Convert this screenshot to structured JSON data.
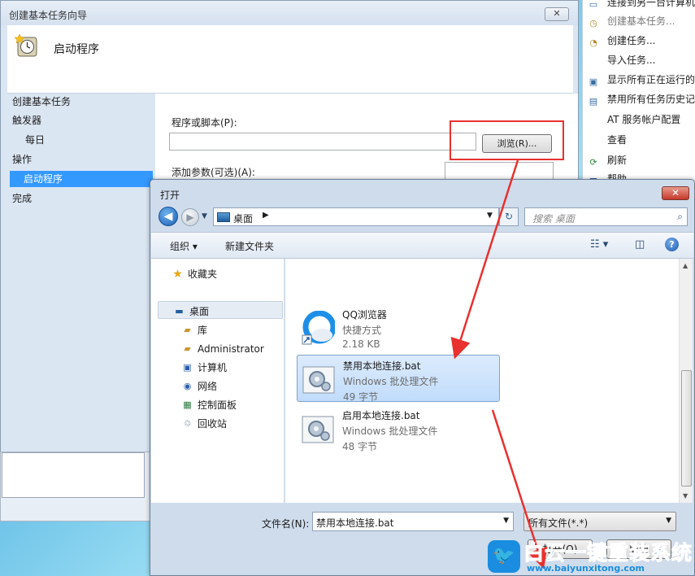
{
  "wizard": {
    "title": "创建基本任务向导",
    "close_label": "✕",
    "header_title": "启动程序",
    "nav": {
      "create": "创建基本任务",
      "trigger": "触发器",
      "daily": "每日",
      "action": "操作",
      "start_program": "启动程序",
      "finish": "完成"
    },
    "program_label": "程序或脚本(P):",
    "browse_label": "浏览(R)...",
    "args_label": "添加参数(可选)(A):"
  },
  "actions_panel": {
    "items": [
      {
        "label": "连接到另一台计算机",
        "icon": "computer-icon"
      },
      {
        "label": "创建基本任务...",
        "icon": "task-wizard-icon"
      },
      {
        "label": "创建任务...",
        "icon": "task-icon"
      },
      {
        "label": "导入任务...",
        "icon": "import-icon"
      },
      {
        "label": "显示所有正在运行的",
        "icon": "running-icon"
      },
      {
        "label": "禁用所有任务历史记",
        "icon": "history-icon"
      },
      {
        "label": "AT 服务帐户配置",
        "icon": "blank-icon"
      },
      {
        "label": "查看",
        "icon": "view-icon"
      },
      {
        "label": "刷新",
        "icon": "refresh-icon"
      },
      {
        "label": "帮助",
        "icon": "help-icon"
      }
    ]
  },
  "open_dialog": {
    "title": "打开",
    "close_label": "✕",
    "address": "桌面",
    "search_placeholder": "搜索 桌面",
    "toolbar": {
      "organize": "组织 ▾",
      "new_folder": "新建文件夹"
    },
    "sidebar": {
      "favorites": "收藏夹",
      "desktop": "桌面",
      "library": "库",
      "admin": "Administrator",
      "computer": "计算机",
      "network": "网络",
      "control_panel": "控制面板",
      "recycle_bin": "回收站"
    },
    "files": [
      {
        "name": "QQ浏览器",
        "type": "快捷方式",
        "size": "2.18 KB",
        "icon": "qq-browser-icon"
      },
      {
        "name": "禁用本地连接.bat",
        "type": "Windows 批处理文件",
        "size": "49 字节",
        "icon": "batch-file-icon"
      },
      {
        "name": "启用本地连接.bat",
        "type": "Windows 批处理文件",
        "size": "48 字节",
        "icon": "batch-file-icon"
      }
    ],
    "filename_label": "文件名(N):",
    "filename_value": "禁用本地连接.bat",
    "filetype_value": "所有文件(*.*)",
    "open_button": "打开(O)",
    "cancel_button": "取消"
  },
  "watermark": {
    "text": "白云一键重装系统",
    "url": "www.baiyunxitong.com"
  },
  "colors": {
    "selection": "#3399ff",
    "annotation_red": "#e8312f",
    "watermark_blue": "#1a8de0"
  }
}
